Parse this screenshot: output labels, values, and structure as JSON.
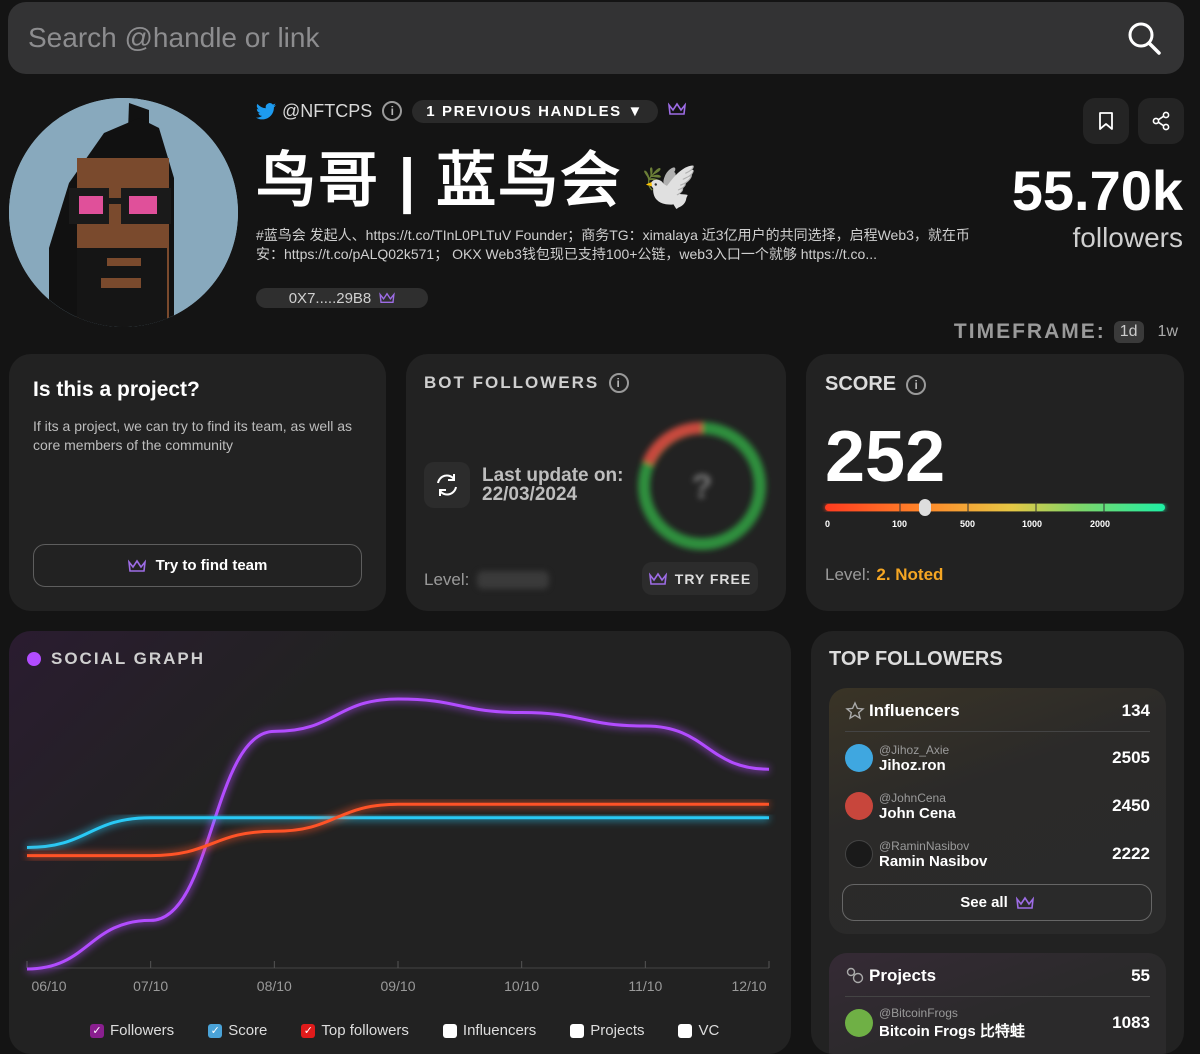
{
  "search": {
    "placeholder": "Search @handle or link"
  },
  "profile": {
    "handle": "@NFTCPS",
    "previous_handles": "1 PREVIOUS HANDLES ▼",
    "name": "鸟哥 | 蓝鸟会",
    "name_emoji": "🕊️",
    "bio": "#蓝鸟会 发起人、https://t.co/TInL0PLTuV Founder；商务TG：ximalaya 近3亿用户的共同选择，启程Web3，就在币安：https://t.co/pALQ02k571； OKX Web3钱包现已支持100+公链，web3入口一个就够 https://t.co...",
    "wallet": "0X7.....29B8",
    "followers_count": "55.70k",
    "followers_label": "followers"
  },
  "timeframe": {
    "label": "TIMEFRAME:",
    "options": [
      "1d",
      "1w"
    ],
    "selected": "1d"
  },
  "project_card": {
    "title": "Is this a project?",
    "desc": "If its a project, we can try to find its team, as well as core members of the community",
    "button": "Try to find team"
  },
  "bot_card": {
    "title": "BOT FOLLOWERS",
    "update_label": "Last update on:",
    "update_date": "22/03/2024",
    "level_label": "Level:",
    "mystery": "?",
    "button": "TRY FREE"
  },
  "score_card": {
    "title": "SCORE",
    "value": "252",
    "ticks": [
      "0",
      "100",
      "500",
      "1000",
      "2000"
    ],
    "marker_value": 252,
    "level_label": "Level:",
    "level_value": "2. Noted"
  },
  "social_graph": {
    "title": "SOCIAL GRAPH",
    "legend": [
      {
        "label": "Followers",
        "checked": true,
        "color": "#a833e8"
      },
      {
        "label": "Score",
        "checked": true,
        "color": "#2a9fd6"
      },
      {
        "label": "Top followers",
        "checked": true,
        "color": "#ff2a2a"
      },
      {
        "label": "Influencers",
        "checked": false,
        "color": "#ffffff"
      },
      {
        "label": "Projects",
        "checked": false,
        "color": "#ffffff"
      },
      {
        "label": "VC",
        "checked": false,
        "color": "#ffffff"
      }
    ]
  },
  "chart_data": {
    "type": "line",
    "x": [
      "06/10",
      "07/10",
      "08/10",
      "09/10",
      "10/10",
      "11/10",
      "12/10"
    ],
    "series": [
      {
        "name": "Followers",
        "color": "#b24cff",
        "values": [
          0.0,
          0.18,
          0.88,
          1.0,
          0.95,
          0.9,
          0.74
        ]
      },
      {
        "name": "Score",
        "color": "#29c9f5",
        "values": [
          0.45,
          0.56,
          0.56,
          0.56,
          0.56,
          0.56,
          0.56
        ]
      },
      {
        "name": "Top followers",
        "color": "#ff5327",
        "values": [
          0.42,
          0.42,
          0.51,
          0.61,
          0.61,
          0.61,
          0.61
        ]
      }
    ],
    "title": "",
    "xlabel": "",
    "ylabel": ""
  },
  "top_followers": {
    "title": "TOP FOLLOWERS",
    "influencers": {
      "label": "Influencers",
      "count": "134",
      "items": [
        {
          "handle": "@Jihoz_Axie",
          "name": "Jihoz.ron",
          "count": "2505",
          "color": "#3fa7e0"
        },
        {
          "handle": "@JohnCena",
          "name": "John Cena",
          "count": "2450",
          "color": "#c8463c"
        },
        {
          "handle": "@RaminNasibov",
          "name": "Ramin Nasibov",
          "count": "2222",
          "color": "#262626"
        }
      ],
      "see_all": "See all"
    },
    "projects": {
      "label": "Projects",
      "count": "55",
      "items": [
        {
          "handle": "@BitcoinFrogs",
          "name": "Bitcoin Frogs 比特蛙",
          "count": "1083",
          "color": "#6fb045"
        }
      ]
    }
  }
}
